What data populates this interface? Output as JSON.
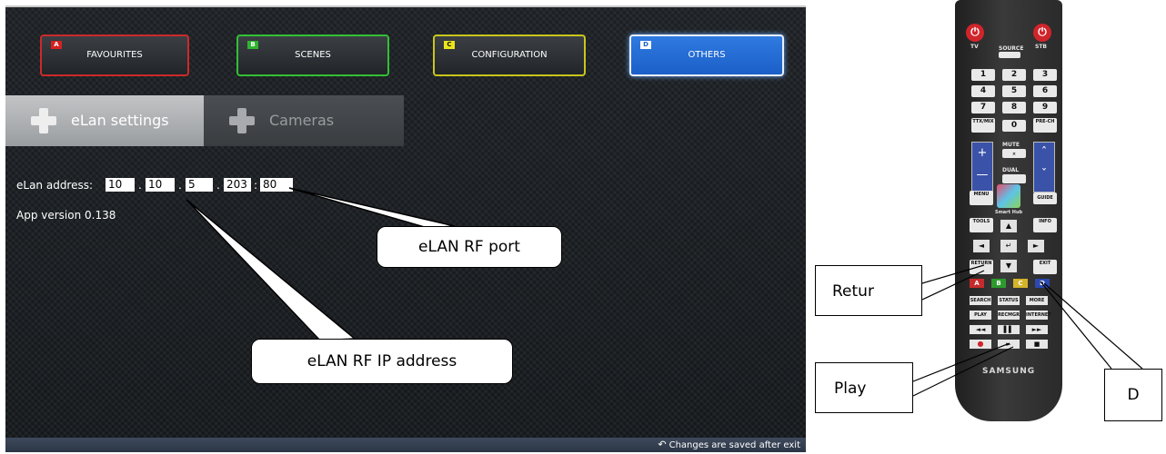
{
  "tv": {
    "color_buttons": [
      {
        "key": "A",
        "label": "FAVOURITES",
        "color": "#d42222"
      },
      {
        "key": "B",
        "label": "SCENES",
        "color": "#2fb52f"
      },
      {
        "key": "C",
        "label": "CONFIGURATION",
        "color": "#e9e41b"
      },
      {
        "key": "D",
        "label": "OTHERS",
        "color": "#1b5fc8"
      }
    ],
    "tabs": [
      {
        "label": "eLan settings",
        "active": true
      },
      {
        "label": "Cameras",
        "active": false
      }
    ],
    "address": {
      "label": "eLan address:",
      "octets": [
        "10",
        "10",
        "5",
        "203"
      ],
      "port": "80",
      "dot": ".",
      "colon": ":"
    },
    "app_version": "App version 0.138",
    "footer_note": "Changes are saved after exit",
    "footer_icon": "undo-icon"
  },
  "remote": {
    "tv_label": "TV",
    "stb_label": "STB",
    "source_label": "SOURCE",
    "digits": [
      "1",
      "2",
      "3",
      "4",
      "5",
      "6",
      "7",
      "8",
      "9",
      "0"
    ],
    "ttx_label": "TTX/MIX",
    "prech_label": "PRE-CH",
    "mute_label": "MUTE",
    "dual_label": "DUAL",
    "menu_label": "MENU",
    "smart_hub_label": "Smart Hub",
    "guide_label": "GUIDE",
    "tools_label": "TOOLS",
    "info_label": "INFO",
    "return_label": "RETURN",
    "exit_label": "EXIT",
    "color_keys": [
      "A",
      "B",
      "C",
      "D"
    ],
    "row1": [
      "SEARCH",
      "STATUS",
      "MORE"
    ],
    "row2": [
      "PLAY",
      "RECMGR",
      "INTERNET"
    ],
    "brand": "SAMSUNG"
  },
  "callouts": {
    "port": "eLAN RF port",
    "ip": "eLAN RF  IP address",
    "retur": "Retur",
    "play": "Play",
    "d": "D"
  }
}
